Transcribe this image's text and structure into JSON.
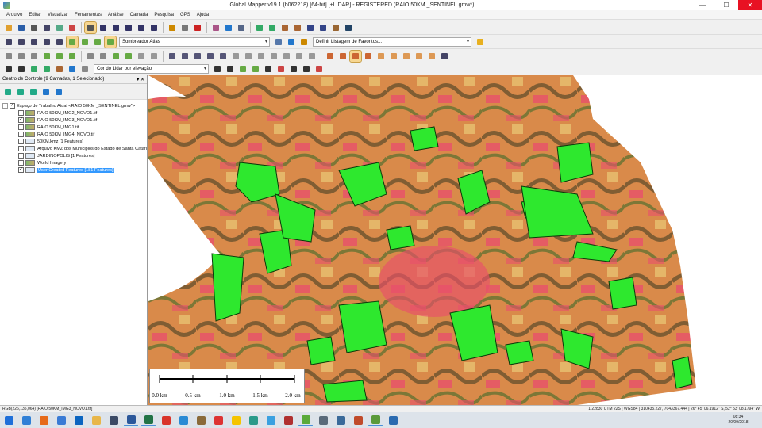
{
  "window": {
    "title": "Global Mapper v19.1 (b062218) [64-bit] [+LIDAR] - REGISTERED (RAIO 50KM _SENTINEL.gmw*)",
    "min": "—",
    "max": "☐",
    "close": "✕"
  },
  "menu": [
    "Arquivo",
    "Editar",
    "Visualizar",
    "Ferramentas",
    "Análise",
    "Camada",
    "Pesquisa",
    "GPS",
    "Ajuda"
  ],
  "toolbar2": {
    "shader": "Sombreador Atlas",
    "favorites": "Definir Listagem de Favoritos..."
  },
  "toolbar4": {
    "lidar_color": "Cor do Lidar por elevação"
  },
  "panel": {
    "title": "Centro de Controle (9 Camadas, 1 Selecionado)",
    "pin": "▾ ✕",
    "root": "Espaço de Trabalho Atual <RAIO 50KM _SENTINEL.gmw*>",
    "layers": [
      {
        "label": "RAIO 50KM_IMG2_NOVO1.tif",
        "checked": false
      },
      {
        "label": "RAIO 50KM_IMG3_NOVO1.tif",
        "checked": true
      },
      {
        "label": "RAIO 50KM_IMG1.tif",
        "checked": false
      },
      {
        "label": "RAIO 50KM_IMG4_NOVO.tif",
        "checked": false
      },
      {
        "label": "50KM.kmz [1 Features]",
        "checked": false
      },
      {
        "label": "Arquivo KMZ dos Municipios do Estado de Santa Catari",
        "checked": false
      },
      {
        "label": "JARDINOPOLIS [1 Features]",
        "checked": false
      },
      {
        "label": "World Imagery",
        "checked": false
      },
      {
        "label": "User Created Features [181 Features]",
        "checked": true,
        "selected": true
      }
    ]
  },
  "scale": {
    "ticks": [
      "0.0 km",
      "0.5 km",
      "1.0 km",
      "1.5 km",
      "2.0 km"
    ]
  },
  "status": {
    "left": "RGB(226,135,064) [RAIO 50KM_IMG3_NOVO1.tif]",
    "right": "1:22830  UTM 22S | WGS84 | 310435.227, 7043367.444 | 26° 45' 06.1912\" S, 52° 53' 08.1794\" W"
  },
  "clock": {
    "time": "08:34",
    "date": "20/09/2018"
  },
  "colors": {
    "forest": "#2ee82e",
    "urban": "#e8506a",
    "field": "#d98a4a",
    "shadow": "#5a4a2a"
  }
}
